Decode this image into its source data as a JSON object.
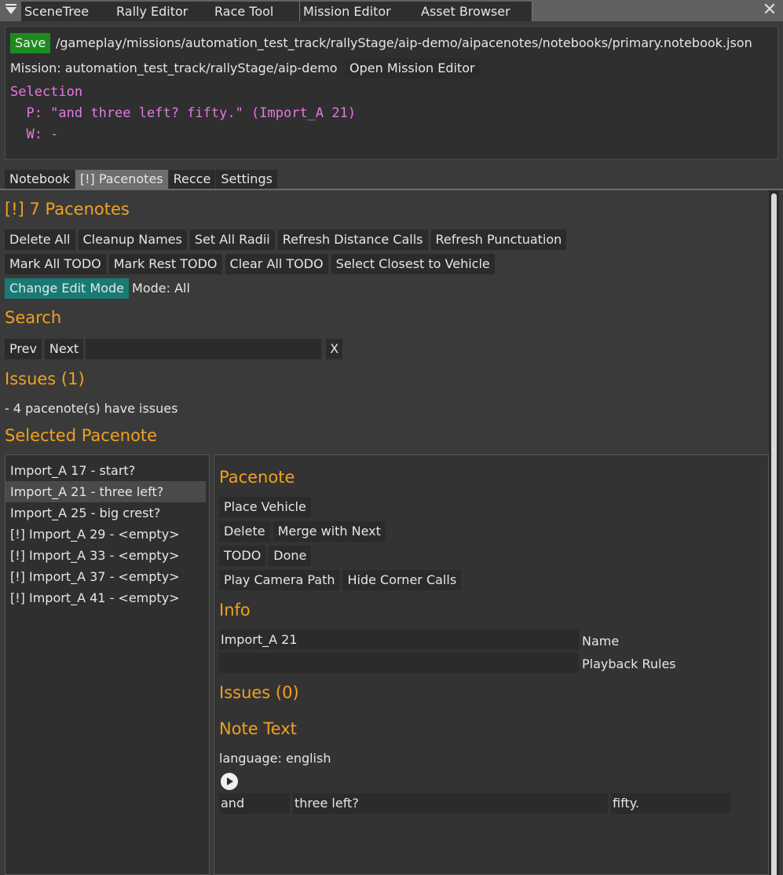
{
  "window_tabs": [
    "SceneTree",
    "Rally Editor",
    "Race Tool",
    "Mission Editor",
    "Asset Browser"
  ],
  "header": {
    "save_label": "Save",
    "file_path": "/gameplay/missions/automation_test_track/rallyStage/aip-demo/aipacenotes/notebooks/primary.notebook.json",
    "mission_label": "Mission: automation_test_track/rallyStage/aip-demo",
    "open_mission_label": "Open Mission Editor",
    "selection_title": "Selection",
    "selection_p": "  P: \"and three left? fifty.\" (Import_A 21)",
    "selection_w": "  W: -"
  },
  "section_tabs": [
    "Notebook",
    "[!] Pacenotes",
    "Recce",
    "Settings"
  ],
  "pacenotes": {
    "title": "[!] 7 Pacenotes",
    "buttons_row1": [
      "Delete All",
      "Cleanup Names",
      "Set All Radii",
      "Refresh Distance Calls",
      "Refresh Punctuation"
    ],
    "buttons_row2": [
      "Mark All TODO",
      "Mark Rest TODO",
      "Clear All TODO",
      "Select Closest to Vehicle"
    ],
    "change_mode_label": "Change Edit Mode",
    "mode_text": "Mode: All",
    "search_title": "Search",
    "prev_label": "Prev",
    "next_label": "Next",
    "search_value": "",
    "clear_label": "X",
    "issues_title": "Issues (1)",
    "issues_text": "- 4 pacenote(s) have issues",
    "selected_title": "Selected Pacenote"
  },
  "pacenote_list": [
    "Import_A 17 - start?",
    "Import_A 21 - three left?",
    "Import_A 25 - big crest?",
    "[!] Import_A 29 - <empty>",
    "[!] Import_A 33 - <empty>",
    "[!] Import_A 37 - <empty>",
    "[!] Import_A 41 - <empty>"
  ],
  "detail": {
    "title": "Pacenote",
    "place_vehicle": "Place Vehicle",
    "delete": "Delete",
    "merge_next": "Merge with Next",
    "todo": "TODO",
    "done": "Done",
    "play_camera": "Play Camera Path",
    "hide_corner": "Hide Corner Calls",
    "info_title": "Info",
    "name_value": "Import_A 21",
    "name_label": "Name",
    "playback_value": "",
    "playback_label": "Playback Rules",
    "issues_title": "Issues (0)",
    "note_text_title": "Note Text",
    "language": "language: english",
    "note_before": "and",
    "note_main": "three left?",
    "note_after": "fifty."
  },
  "colors": {
    "accent": "#f0a020",
    "save_green": "#1c8a1c",
    "mode_teal": "#197a75",
    "selection_magenta": "#e27ae2"
  }
}
